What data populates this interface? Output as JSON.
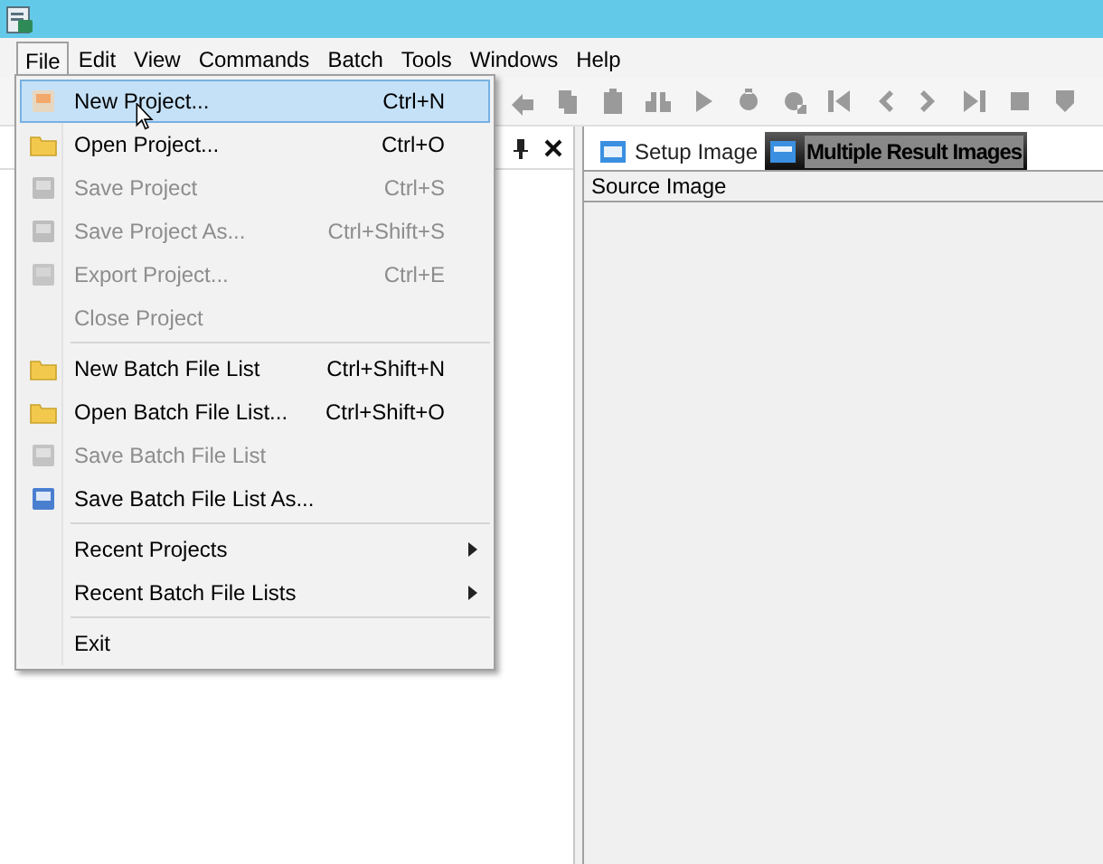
{
  "menubar": [
    {
      "label": "File",
      "selected": true
    },
    {
      "label": "Edit",
      "selected": false
    },
    {
      "label": "View",
      "selected": false
    },
    {
      "label": "Commands",
      "selected": false
    },
    {
      "label": "Batch",
      "selected": false
    },
    {
      "label": "Tools",
      "selected": false
    },
    {
      "label": "Windows",
      "selected": false
    },
    {
      "label": "Help",
      "selected": false
    }
  ],
  "file_menu": [
    {
      "kind": "item",
      "label": "New Project...",
      "shortcut": "Ctrl+N",
      "disabled": false,
      "selected": true,
      "submenu": false
    },
    {
      "kind": "item",
      "label": "Open Project...",
      "shortcut": "Ctrl+O",
      "disabled": false,
      "selected": false,
      "submenu": false
    },
    {
      "kind": "item",
      "label": "Save Project",
      "shortcut": "Ctrl+S",
      "disabled": true,
      "selected": false,
      "submenu": false
    },
    {
      "kind": "item",
      "label": "Save Project As...",
      "shortcut": "Ctrl+Shift+S",
      "disabled": true,
      "selected": false,
      "submenu": false
    },
    {
      "kind": "item",
      "label": "Export Project...",
      "shortcut": "Ctrl+E",
      "disabled": true,
      "selected": false,
      "submenu": false
    },
    {
      "kind": "item",
      "label": "Close Project",
      "disabled": true,
      "selected": false,
      "submenu": false
    },
    {
      "kind": "separator"
    },
    {
      "kind": "item",
      "label": "New Batch File List",
      "shortcut": "Ctrl+Shift+N",
      "disabled": false,
      "selected": false,
      "submenu": false
    },
    {
      "kind": "item",
      "label": "Open Batch File List...",
      "shortcut": "Ctrl+Shift+O",
      "disabled": false,
      "selected": false,
      "submenu": false
    },
    {
      "kind": "item",
      "label": "Save Batch File List",
      "disabled": true,
      "selected": false,
      "submenu": false
    },
    {
      "kind": "item",
      "label": "Save Batch File List As...",
      "disabled": false,
      "selected": false,
      "submenu": false
    },
    {
      "kind": "separator"
    },
    {
      "kind": "item",
      "label": "Recent Projects",
      "disabled": false,
      "selected": false,
      "submenu": true
    },
    {
      "kind": "item",
      "label": "Recent Batch File Lists",
      "disabled": false,
      "selected": false,
      "submenu": true
    },
    {
      "kind": "separator"
    },
    {
      "kind": "item",
      "label": "Exit",
      "disabled": false,
      "selected": false,
      "submenu": false
    }
  ],
  "tabs": [
    {
      "label": "Setup Image",
      "selected": false
    },
    {
      "label": "Multiple Result Images",
      "selected": true
    }
  ],
  "image_panel": {
    "header": "Source Image"
  }
}
